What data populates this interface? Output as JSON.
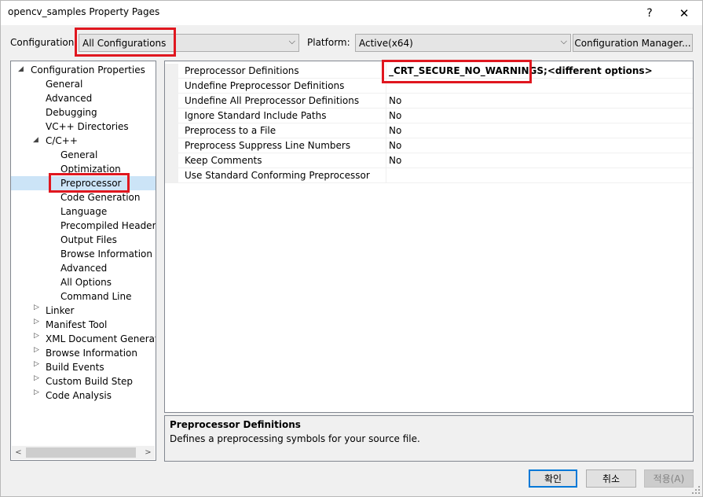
{
  "window": {
    "title": "opencv_samples Property Pages",
    "help_glyph": "?",
    "close_glyph": "✕"
  },
  "toolbar": {
    "configuration_label": "Configuration:",
    "configuration_value": "All Configurations",
    "platform_label": "Platform:",
    "platform_value": "Active(x64)",
    "config_manager_label": "Configuration Manager..."
  },
  "tree": {
    "root": "Configuration Properties",
    "items": [
      {
        "label": "General"
      },
      {
        "label": "Advanced"
      },
      {
        "label": "Debugging"
      },
      {
        "label": "VC++ Directories"
      },
      {
        "label": "C/C++"
      },
      {
        "label": "General"
      },
      {
        "label": "Optimization"
      },
      {
        "label": "Preprocessor"
      },
      {
        "label": "Code Generation"
      },
      {
        "label": "Language"
      },
      {
        "label": "Precompiled Headers"
      },
      {
        "label": "Output Files"
      },
      {
        "label": "Browse Information"
      },
      {
        "label": "Advanced"
      },
      {
        "label": "All Options"
      },
      {
        "label": "Command Line"
      },
      {
        "label": "Linker"
      },
      {
        "label": "Manifest Tool"
      },
      {
        "label": "XML Document Generator"
      },
      {
        "label": "Browse Information"
      },
      {
        "label": "Build Events"
      },
      {
        "label": "Custom Build Step"
      },
      {
        "label": "Code Analysis"
      }
    ]
  },
  "grid": {
    "rows": [
      {
        "name": "Preprocessor Definitions",
        "value": "_CRT_SECURE_NO_WARNINGS;<different options>"
      },
      {
        "name": "Undefine Preprocessor Definitions",
        "value": ""
      },
      {
        "name": "Undefine All Preprocessor Definitions",
        "value": "No"
      },
      {
        "name": "Ignore Standard Include Paths",
        "value": "No"
      },
      {
        "name": "Preprocess to a File",
        "value": "No"
      },
      {
        "name": "Preprocess Suppress Line Numbers",
        "value": "No"
      },
      {
        "name": "Keep Comments",
        "value": "No"
      },
      {
        "name": "Use Standard Conforming Preprocessor",
        "value": ""
      }
    ]
  },
  "description": {
    "title": "Preprocessor Definitions",
    "text": "Defines a preprocessing symbols for your source file."
  },
  "buttons": {
    "ok": "확인",
    "cancel": "취소",
    "apply": "적용(A)"
  },
  "colors": {
    "highlight": "#e0171f",
    "selection": "#cce4f7",
    "accent": "#0078d7"
  }
}
